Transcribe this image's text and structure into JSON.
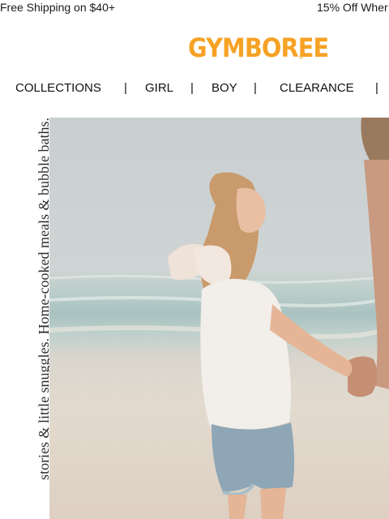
{
  "promo": {
    "left": "Free Shipping on $40+",
    "right": "15% Off Wher"
  },
  "brand": {
    "name": "GYMBOREE",
    "registered": "®",
    "color": "#f6a225"
  },
  "nav": {
    "items": [
      "COLLECTIONS",
      "GIRL",
      "BOY",
      "CLEARANCE"
    ],
    "separator": "|"
  },
  "hero": {
    "tagline": "stories & little snuggles. Home-cooked meals & bubble baths."
  }
}
